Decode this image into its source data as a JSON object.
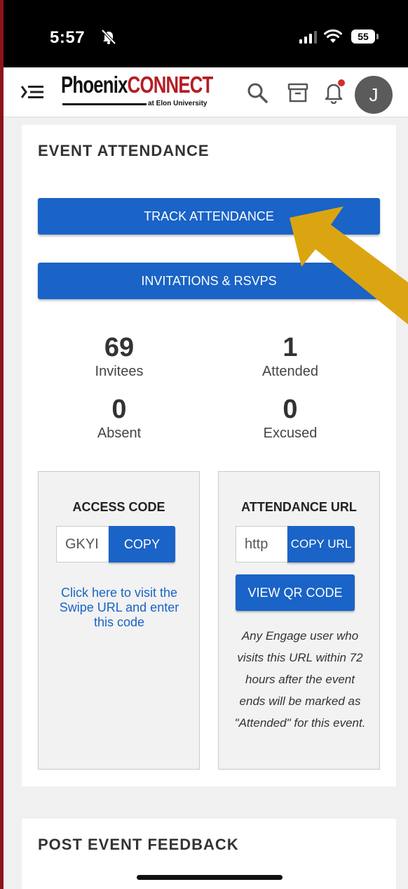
{
  "status_bar": {
    "time": "5:57",
    "battery": "55"
  },
  "app": {
    "logo_primary": "Phoenix",
    "logo_accent": "CONNECT",
    "logo_sub": "at Elon University",
    "avatar_initial": "J"
  },
  "attendance": {
    "title": "EVENT ATTENDANCE",
    "track_button": "TRACK ATTENDANCE",
    "invitations_button": "INVITATIONS & RSVPS",
    "stats": [
      {
        "value": "69",
        "label": "Invitees"
      },
      {
        "value": "1",
        "label": "Attended"
      },
      {
        "value": "0",
        "label": "Absent"
      },
      {
        "value": "0",
        "label": "Excused"
      }
    ],
    "access_code": {
      "title": "ACCESS CODE",
      "value": "GKYI",
      "copy_button": "COPY",
      "link_text": "Click here to visit the Swipe URL and enter this code"
    },
    "attendance_url": {
      "title": "ATTENDANCE URL",
      "value": "http",
      "copy_button": "COPY URL",
      "qr_button": "VIEW QR CODE",
      "note": "Any Engage user who visits this URL within 72 hours after the event ends will be marked as \"Attended\" for this event."
    }
  },
  "feedback": {
    "title": "POST EVENT FEEDBACK"
  },
  "colors": {
    "primary": "#1a63c7",
    "brand_red": "#b41e24",
    "arrow": "#dba512",
    "frame": "#8b1518"
  },
  "icons": [
    "bell-off-icon",
    "signal-icon",
    "wifi-icon",
    "battery-icon",
    "menu-icon",
    "search-icon",
    "archive-icon",
    "notification-bell-icon",
    "annotation-arrow-icon"
  ]
}
